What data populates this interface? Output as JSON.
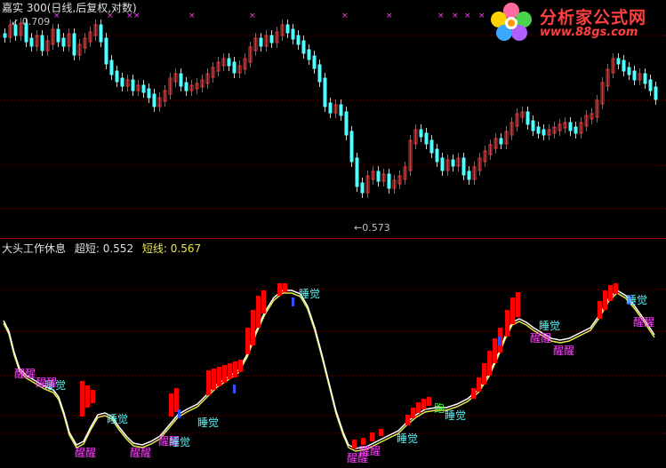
{
  "main_chart": {
    "title": "嘉实 300(日线,后复权,对数)",
    "high_label": "0.709",
    "low_label": "0.573"
  },
  "indicator": {
    "name": "大头工作休息",
    "super_short_label": "超短:",
    "super_short_value": "0.552",
    "short_label": "短线:",
    "short_value": "0.567",
    "labels": {
      "sleep": "睡觉",
      "wake": "醒醒",
      "run": "跑"
    }
  },
  "logo": {
    "text": "分析家公式网",
    "url": "www.88gs.com"
  },
  "colors": {
    "up_candle": "#ff3030",
    "down_candle": "#54ffff",
    "grid": "#800000",
    "super_short_line": "#ffffff",
    "short_line": "#e8e84a",
    "bar_red": "#ff0000",
    "bar_blue": "#3050ff",
    "sleep_label": "#54ffff",
    "wake_label": "#ff40ff"
  }
}
